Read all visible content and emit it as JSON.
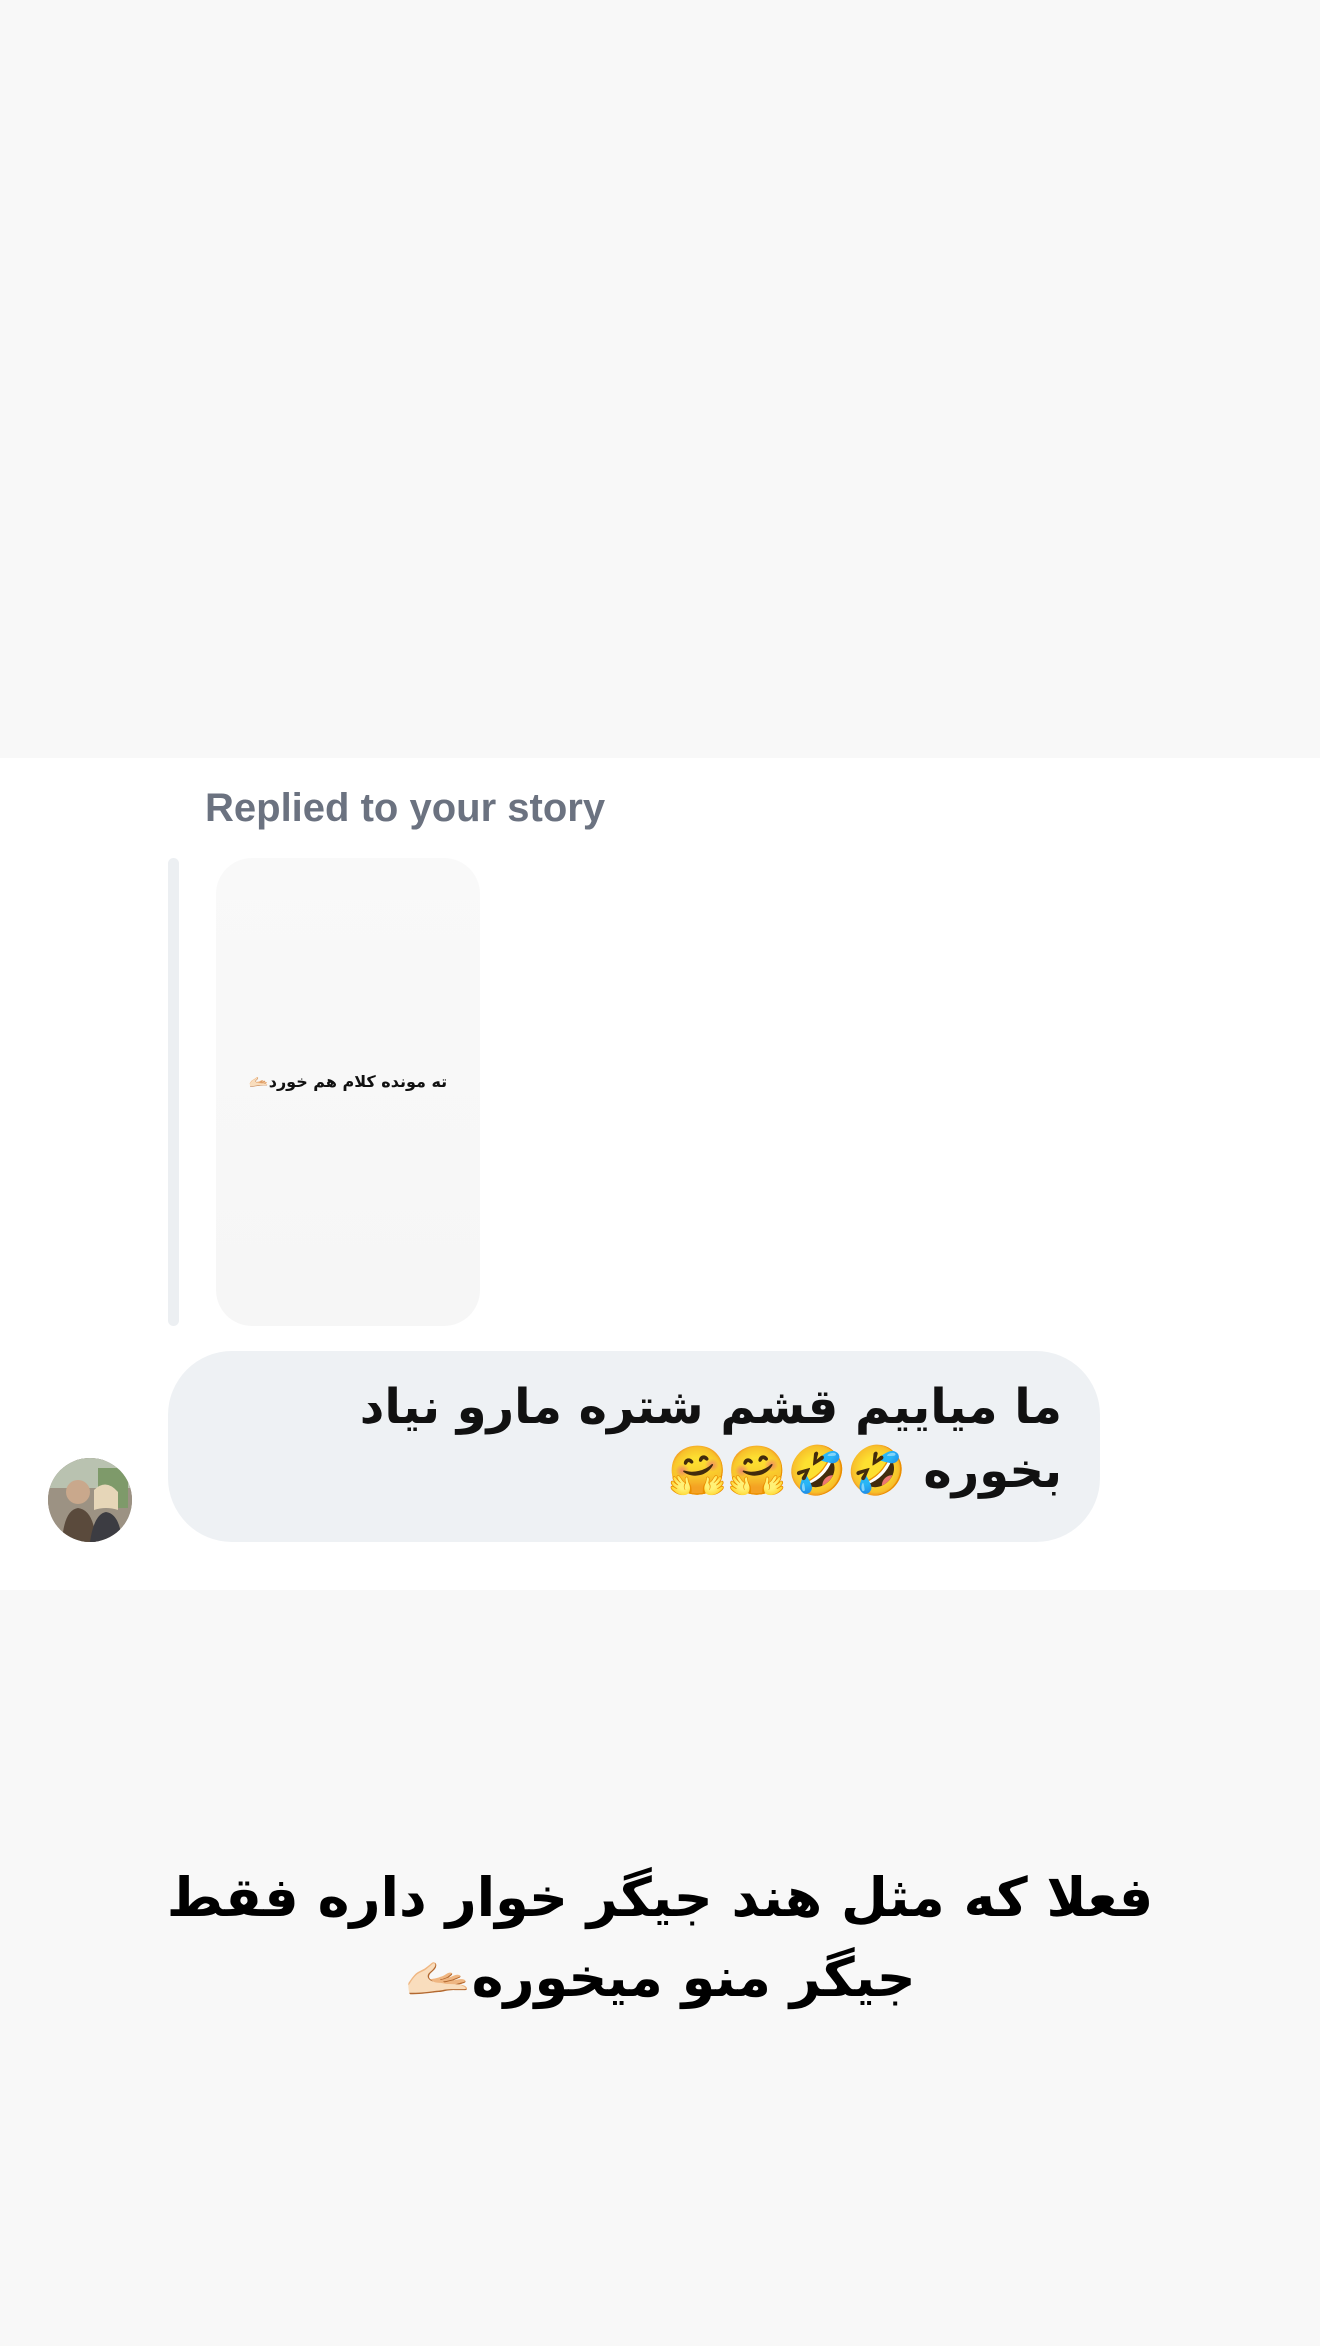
{
  "reply_context": {
    "label": "Replied to your story",
    "story_preview_text": "ته مونده کلام هم خورد🫴🏻"
  },
  "message": {
    "text": "ما میاییم قشم شتره مارو نیاد بخوره 🤣🤣🤗🤗",
    "bubble_color": "#eef1f4",
    "sender_avatar_icon": "avatar-photo"
  },
  "story": {
    "caption": "فعلا که مثل هند جیگر خوار داره فقط جیگر منو میخوره🫴🏻"
  },
  "colors": {
    "background": "#f8f8f8",
    "card": "#ffffff",
    "label_gray": "#6b7280"
  }
}
